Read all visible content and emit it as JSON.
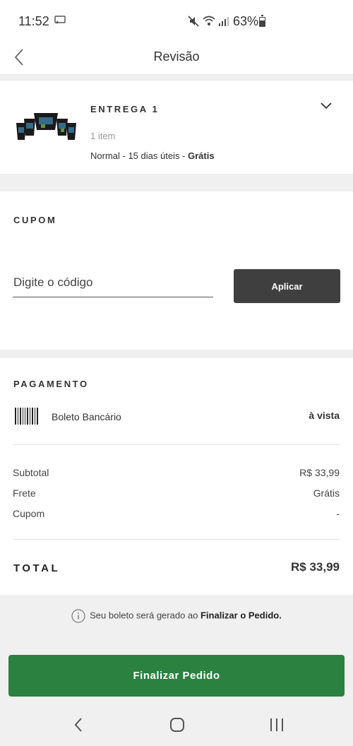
{
  "status_bar": {
    "time": "11:52",
    "battery_percent": "63%",
    "icons": [
      "cast-icon",
      "mute-icon",
      "wifi-icon",
      "signal-icon",
      "battery-icon"
    ]
  },
  "header": {
    "title": "Revisão"
  },
  "delivery": {
    "title": "ENTREGA  1",
    "items_count": "1 item",
    "shipping_type": "Normal - 15 dias úteis - ",
    "shipping_price": "Grátis"
  },
  "coupon": {
    "title": "CUPOM",
    "placeholder": "Digite o código",
    "apply_label": "Aplicar"
  },
  "payment": {
    "title": "PAGAMENTO",
    "method": "Boleto Bancário",
    "terms": "à vista",
    "summary": [
      {
        "label": "Subtotal",
        "value": "R$ 33,99"
      },
      {
        "label": "Frete",
        "value": "Grátis"
      },
      {
        "label": "Cupom",
        "value": "-"
      }
    ],
    "total_label": "TOTAL",
    "total_value": "R$ 33,99"
  },
  "notice": {
    "text": "Seu boleto será gerado ao ",
    "emphasis": "Finalizar o Pedido."
  },
  "finalize_label": "Finalizar Pedido",
  "colors": {
    "primary_green": "#2a8140",
    "apply_button": "#3f3f3f",
    "background": "#f0f0f0"
  }
}
